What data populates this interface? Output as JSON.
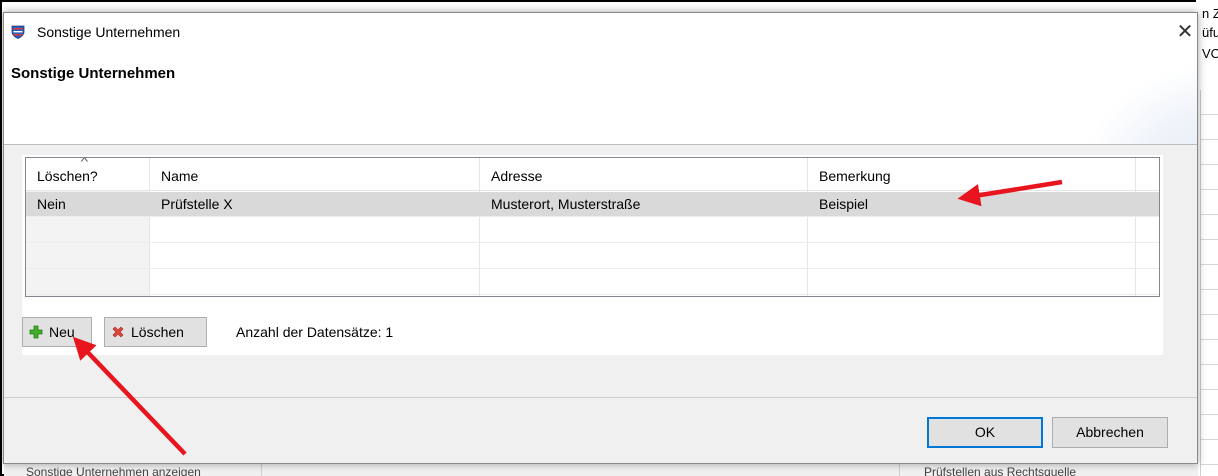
{
  "background": {
    "right_text_lines": [
      "n Z",
      "üfu",
      "VO"
    ],
    "bottom_left_text": "Sonstige Unternehmen anzeigen",
    "bottom_right_text": "Prüfstellen aus Rechtsquelle"
  },
  "dialog": {
    "window_title": "Sonstige Unternehmen",
    "header_title": "Sonstige Unternehmen",
    "close_glyph": "✕",
    "grid": {
      "columns": [
        "Löschen?",
        "Name",
        "Adresse",
        "Bemerkung"
      ],
      "sort_glyph": "^",
      "rows": [
        {
          "loeschen": "Nein",
          "name": "Prüfstelle X",
          "adresse": "Musterort, Musterstraße",
          "bemerkung": "Beispiel"
        }
      ]
    },
    "toolbar": {
      "new_label": "Neu",
      "delete_label": "Löschen",
      "record_count": "Anzahl der Datensätze: 1"
    },
    "buttons": {
      "ok_label": "OK",
      "cancel_label": "Abbrechen"
    }
  },
  "colors": {
    "accent": "#0078d7",
    "annotation_arrow": "#e8141e",
    "add_icon": "#3fae29",
    "delete_icon": "#e0443a"
  }
}
